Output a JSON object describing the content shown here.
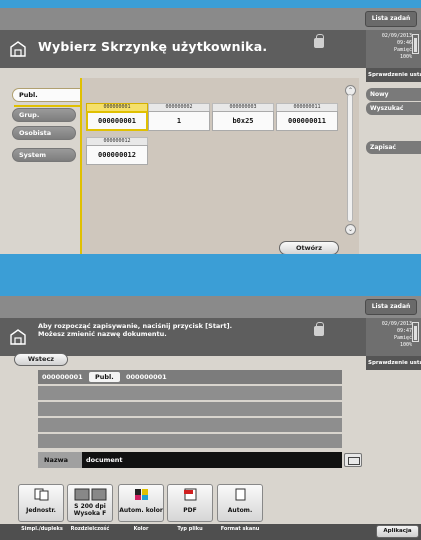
{
  "colors": {
    "background": "#3b9ed6",
    "accent": "#e0c000",
    "chrome": "#5e5e5e"
  },
  "common": {
    "lista_zadan": "Lista zadań",
    "sprawdzenie": "Sprawdzenie ustawień",
    "date": "02/09/2013"
  },
  "screen1": {
    "title": "Wybierz Skrzynkę użytkownika.",
    "time": "09:46",
    "memory_label": "Pamięć",
    "memory_value": "100%",
    "tabs": [
      "Publ.",
      "Grup.",
      "Osobista",
      "System"
    ],
    "boxes": [
      {
        "tab": "000000001",
        "name": "000000001"
      },
      {
        "tab": "000000002",
        "name": "1"
      },
      {
        "tab": "000000003",
        "name": "b0x25"
      },
      {
        "tab": "000000011",
        "name": "000000011"
      },
      {
        "tab": "000000012",
        "name": "000000012"
      }
    ],
    "open_button": "Otwórz",
    "right_menu": {
      "new": "Nowy",
      "search": "Wyszukać",
      "save": "Zapisać"
    }
  },
  "screen2": {
    "message_line1": "Aby rozpocząć zapisywanie, naciśnij przycisk [Start].",
    "message_line2": "Możesz zmienić nazwę dokumentu.",
    "time": "09:47",
    "memory_label": "Pamięć",
    "memory_value": "100%",
    "back_button": "Wstecz",
    "path": {
      "box_number": "000000001",
      "type": "Publ.",
      "box_name": "000000001"
    },
    "name_label": "Nazwa",
    "name_value": "document",
    "functions": [
      {
        "label": "Jednostr.",
        "caption": "Simpl./dupleks"
      },
      {
        "label1": "S 200 dpi",
        "label2": "Wysoka F",
        "caption": "Rozdzielczość"
      },
      {
        "label": "Autom. kolor",
        "caption": "Kolor"
      },
      {
        "label": "PDF",
        "caption": "Typ pliku"
      },
      {
        "label": "Autom.",
        "caption": "Format skanu"
      }
    ],
    "application_button": "Aplikacja"
  }
}
